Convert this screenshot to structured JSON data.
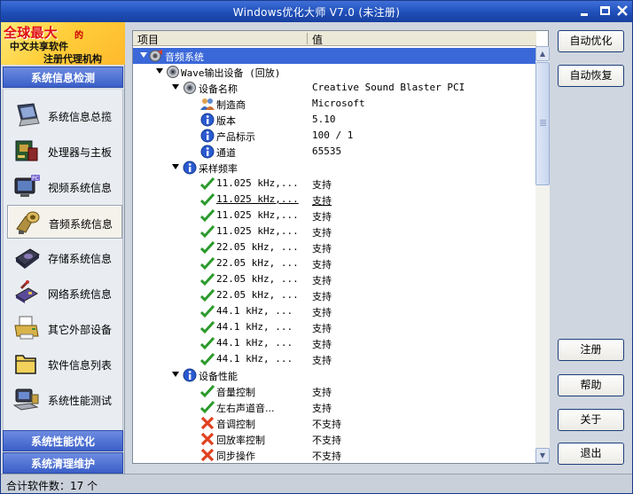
{
  "window": {
    "title": "Windows优化大师 V7.0 (未注册)",
    "controls": {
      "minimize": "minimize-icon",
      "maximize": "maximize-icon",
      "close": "close-icon"
    }
  },
  "logo": {
    "line1": "全球最大",
    "de": "的",
    "line2": "中文共享软件",
    "line3": "注册代理机构"
  },
  "sections": {
    "detect": "系统信息检测",
    "optimize": "系统性能优化",
    "clean": "系统清理维护"
  },
  "nav": [
    {
      "label": "系统信息总揽",
      "icon": "laptop-icon"
    },
    {
      "label": "处理器与主板",
      "icon": "cpu-board-icon"
    },
    {
      "label": "视频系统信息",
      "icon": "monitor-icon"
    },
    {
      "label": "音频系统信息",
      "icon": "speaker-icon",
      "selected": true
    },
    {
      "label": "存储系统信息",
      "icon": "disk-icon"
    },
    {
      "label": "网络系统信息",
      "icon": "network-icon"
    },
    {
      "label": "其它外部设备",
      "icon": "printer-icon"
    },
    {
      "label": "软件信息列表",
      "icon": "folder-icon"
    },
    {
      "label": "系统性能测试",
      "icon": "computer-test-icon"
    }
  ],
  "tree": {
    "col_item": "项目",
    "col_value": "值",
    "rows": [
      {
        "name": "音频系统",
        "value": "",
        "level": 0,
        "icon": "audio-system-icon",
        "toggle": true,
        "highlight": true
      },
      {
        "name": "Wave输出设备 (回放)",
        "value": "",
        "level": 1,
        "icon": "speaker-device-icon",
        "toggle": true
      },
      {
        "name": "设备名称",
        "value": "Creative Sound Blaster PCI",
        "level": 2,
        "icon": "speaker-device-icon",
        "toggle": true
      },
      {
        "name": "制造商",
        "value": "Microsoft",
        "level": 3,
        "icon": "people-icon"
      },
      {
        "name": "版本",
        "value": "5.10",
        "level": 3,
        "icon": "info-icon"
      },
      {
        "name": "产品标示",
        "value": "100 / 1",
        "level": 3,
        "icon": "info-icon"
      },
      {
        "name": "通道",
        "value": "65535",
        "level": 3,
        "icon": "info-icon"
      },
      {
        "name": "采样频率",
        "value": "",
        "level": 2,
        "icon": "info-icon",
        "toggle": true
      },
      {
        "name": "11.025 kHz,...",
        "value": "支持",
        "level": 3,
        "icon": "check-icon"
      },
      {
        "name": "11.025 kHz,...",
        "value": "支持",
        "level": 3,
        "icon": "check-icon",
        "underline": true
      },
      {
        "name": "11.025 kHz,...",
        "value": "支持",
        "level": 3,
        "icon": "check-icon"
      },
      {
        "name": "11.025 kHz,...",
        "value": "支持",
        "level": 3,
        "icon": "check-icon"
      },
      {
        "name": "22.05 kHz, ...",
        "value": "支持",
        "level": 3,
        "icon": "check-icon"
      },
      {
        "name": "22.05 kHz, ...",
        "value": "支持",
        "level": 3,
        "icon": "check-icon"
      },
      {
        "name": "22.05 kHz, ...",
        "value": "支持",
        "level": 3,
        "icon": "check-icon"
      },
      {
        "name": "22.05 kHz, ...",
        "value": "支持",
        "level": 3,
        "icon": "check-icon"
      },
      {
        "name": "44.1 kHz, ...",
        "value": "支持",
        "level": 3,
        "icon": "check-icon"
      },
      {
        "name": "44.1 kHz, ...",
        "value": "支持",
        "level": 3,
        "icon": "check-icon"
      },
      {
        "name": "44.1 kHz, ...",
        "value": "支持",
        "level": 3,
        "icon": "check-icon"
      },
      {
        "name": "44.1 kHz, ...",
        "value": "支持",
        "level": 3,
        "icon": "check-icon"
      },
      {
        "name": "设备性能",
        "value": "",
        "level": 2,
        "icon": "info-icon",
        "toggle": true
      },
      {
        "name": "音量控制",
        "value": "支持",
        "level": 3,
        "icon": "check-icon"
      },
      {
        "name": "左右声道音...",
        "value": "支持",
        "level": 3,
        "icon": "check-icon"
      },
      {
        "name": "音调控制",
        "value": "不支持",
        "level": 3,
        "icon": "cross-icon"
      },
      {
        "name": "回放率控制",
        "value": "不支持",
        "level": 3,
        "icon": "cross-icon"
      },
      {
        "name": "同步操作",
        "value": "不支持",
        "level": 3,
        "icon": "cross-icon"
      }
    ]
  },
  "buttons": {
    "auto_optimize": "自动优化",
    "auto_restore": "自动恢复",
    "register": "注册",
    "help": "帮助",
    "about": "关于",
    "exit": "退出"
  },
  "status": {
    "text": "合计软件数：17 个"
  },
  "colors": {
    "title_bar": "#2456c8",
    "selection": "#3a68d8",
    "check": "#2a9a2a",
    "cross": "#e04020",
    "info": "#2a5ad0"
  }
}
